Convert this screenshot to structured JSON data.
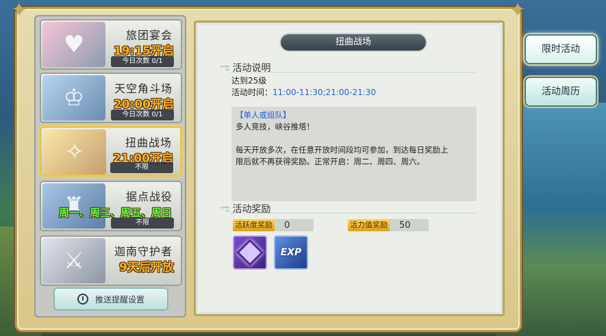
{
  "events": [
    {
      "name": "旅团宴会",
      "time": "19:15开启",
      "count": "今日次数 0/1",
      "selected": false,
      "time_color": "orange"
    },
    {
      "name": "天空角斗场",
      "time": "20:00开启",
      "count": "今日次数 0/1",
      "selected": false,
      "time_color": "orange"
    },
    {
      "name": "扭曲战场",
      "time": "21:00开启",
      "count": "不限",
      "selected": true,
      "time_color": "orange"
    },
    {
      "name": "据点战役",
      "time": "周一、周三、周五、周日",
      "count": "不限",
      "selected": false,
      "time_color": "green"
    },
    {
      "name": "迦南守护者",
      "time": "9天后开放",
      "count": "",
      "selected": false,
      "time_color": "orange"
    }
  ],
  "remind_button": {
    "label": "推送提醒设置",
    "icon": "clock-icon"
  },
  "detail": {
    "title": "扭曲战场",
    "desc_heading": "活动说明",
    "level_req": "达到25级",
    "time_label": "活动时间：",
    "time_value": "11:00-11:30;21:00-21:30",
    "mode_tag": "【单人或组队】",
    "line1": "多人竞技，峡谷推塔！",
    "line2": "每天开放多次，在任意开放时间段均可参加，到达每日奖励上",
    "line3": "限后就不再获得奖励。正常开启：周二、周四、周六。",
    "reward_heading": "活动奖励",
    "activity_label": "活跃度奖励",
    "activity_value": "0",
    "vitality_label": "活力值奖励",
    "vitality_value": "50",
    "reward_items": [
      "gem-icon",
      "exp-icon"
    ],
    "exp_text": "EXP"
  },
  "side_tabs": [
    {
      "label": "限时活动",
      "active": true
    },
    {
      "label": "活动周历",
      "active": false
    }
  ],
  "colors": {
    "time_orange": "#ffb21a",
    "time_green": "#6bff4a",
    "link_blue": "#1f5fd6",
    "frame_gold": "#b49a56"
  }
}
